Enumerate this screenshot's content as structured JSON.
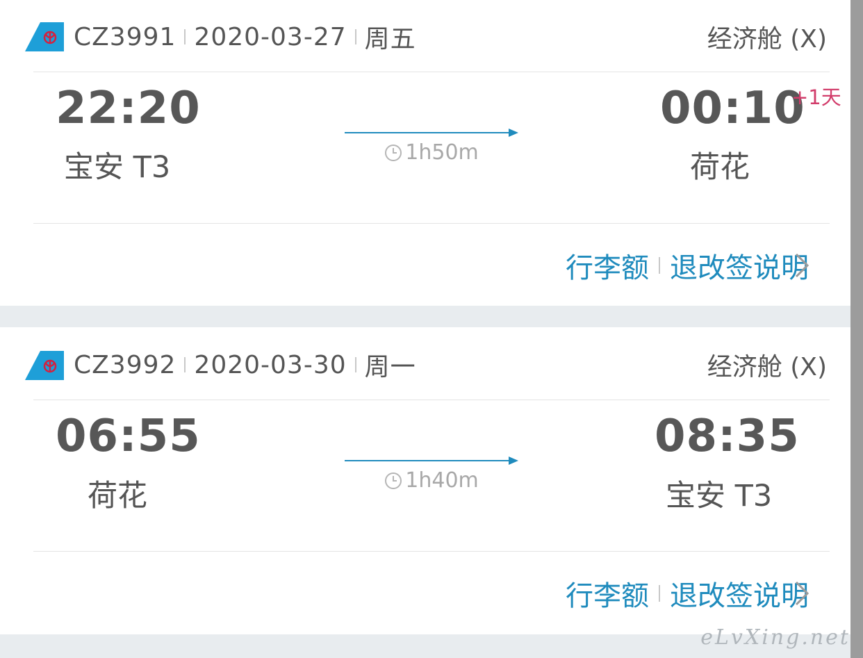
{
  "flights": [
    {
      "flight_no": "CZ3991",
      "date": "2020-03-27",
      "weekday": "周五",
      "cabin": "经济舱 (X)",
      "depart_time": "22:20",
      "depart_airport": "宝安 T3",
      "arrive_time": "00:10",
      "arrive_day_offset": "+1天",
      "arrive_airport": "荷花",
      "duration": "1h50m",
      "baggage_link": "行李额",
      "refund_link": "退改签说明"
    },
    {
      "flight_no": "CZ3992",
      "date": "2020-03-30",
      "weekday": "周一",
      "cabin": "经济舱 (X)",
      "depart_time": "06:55",
      "depart_airport": "荷花",
      "arrive_time": "08:35",
      "arrive_airport": "宝安 T3",
      "duration": "1h40m",
      "baggage_link": "行李额",
      "refund_link": "退改签说明"
    }
  ],
  "watermark": "eLvXing.net",
  "colors": {
    "link": "#1f8bbd",
    "day_offset": "#d23d6b",
    "airline_logo": "#1e9fd8"
  },
  "icons": {
    "airline_logo": "china-southern-logo-icon",
    "clock": "clock-icon",
    "chevron": "chevron-right-icon"
  }
}
